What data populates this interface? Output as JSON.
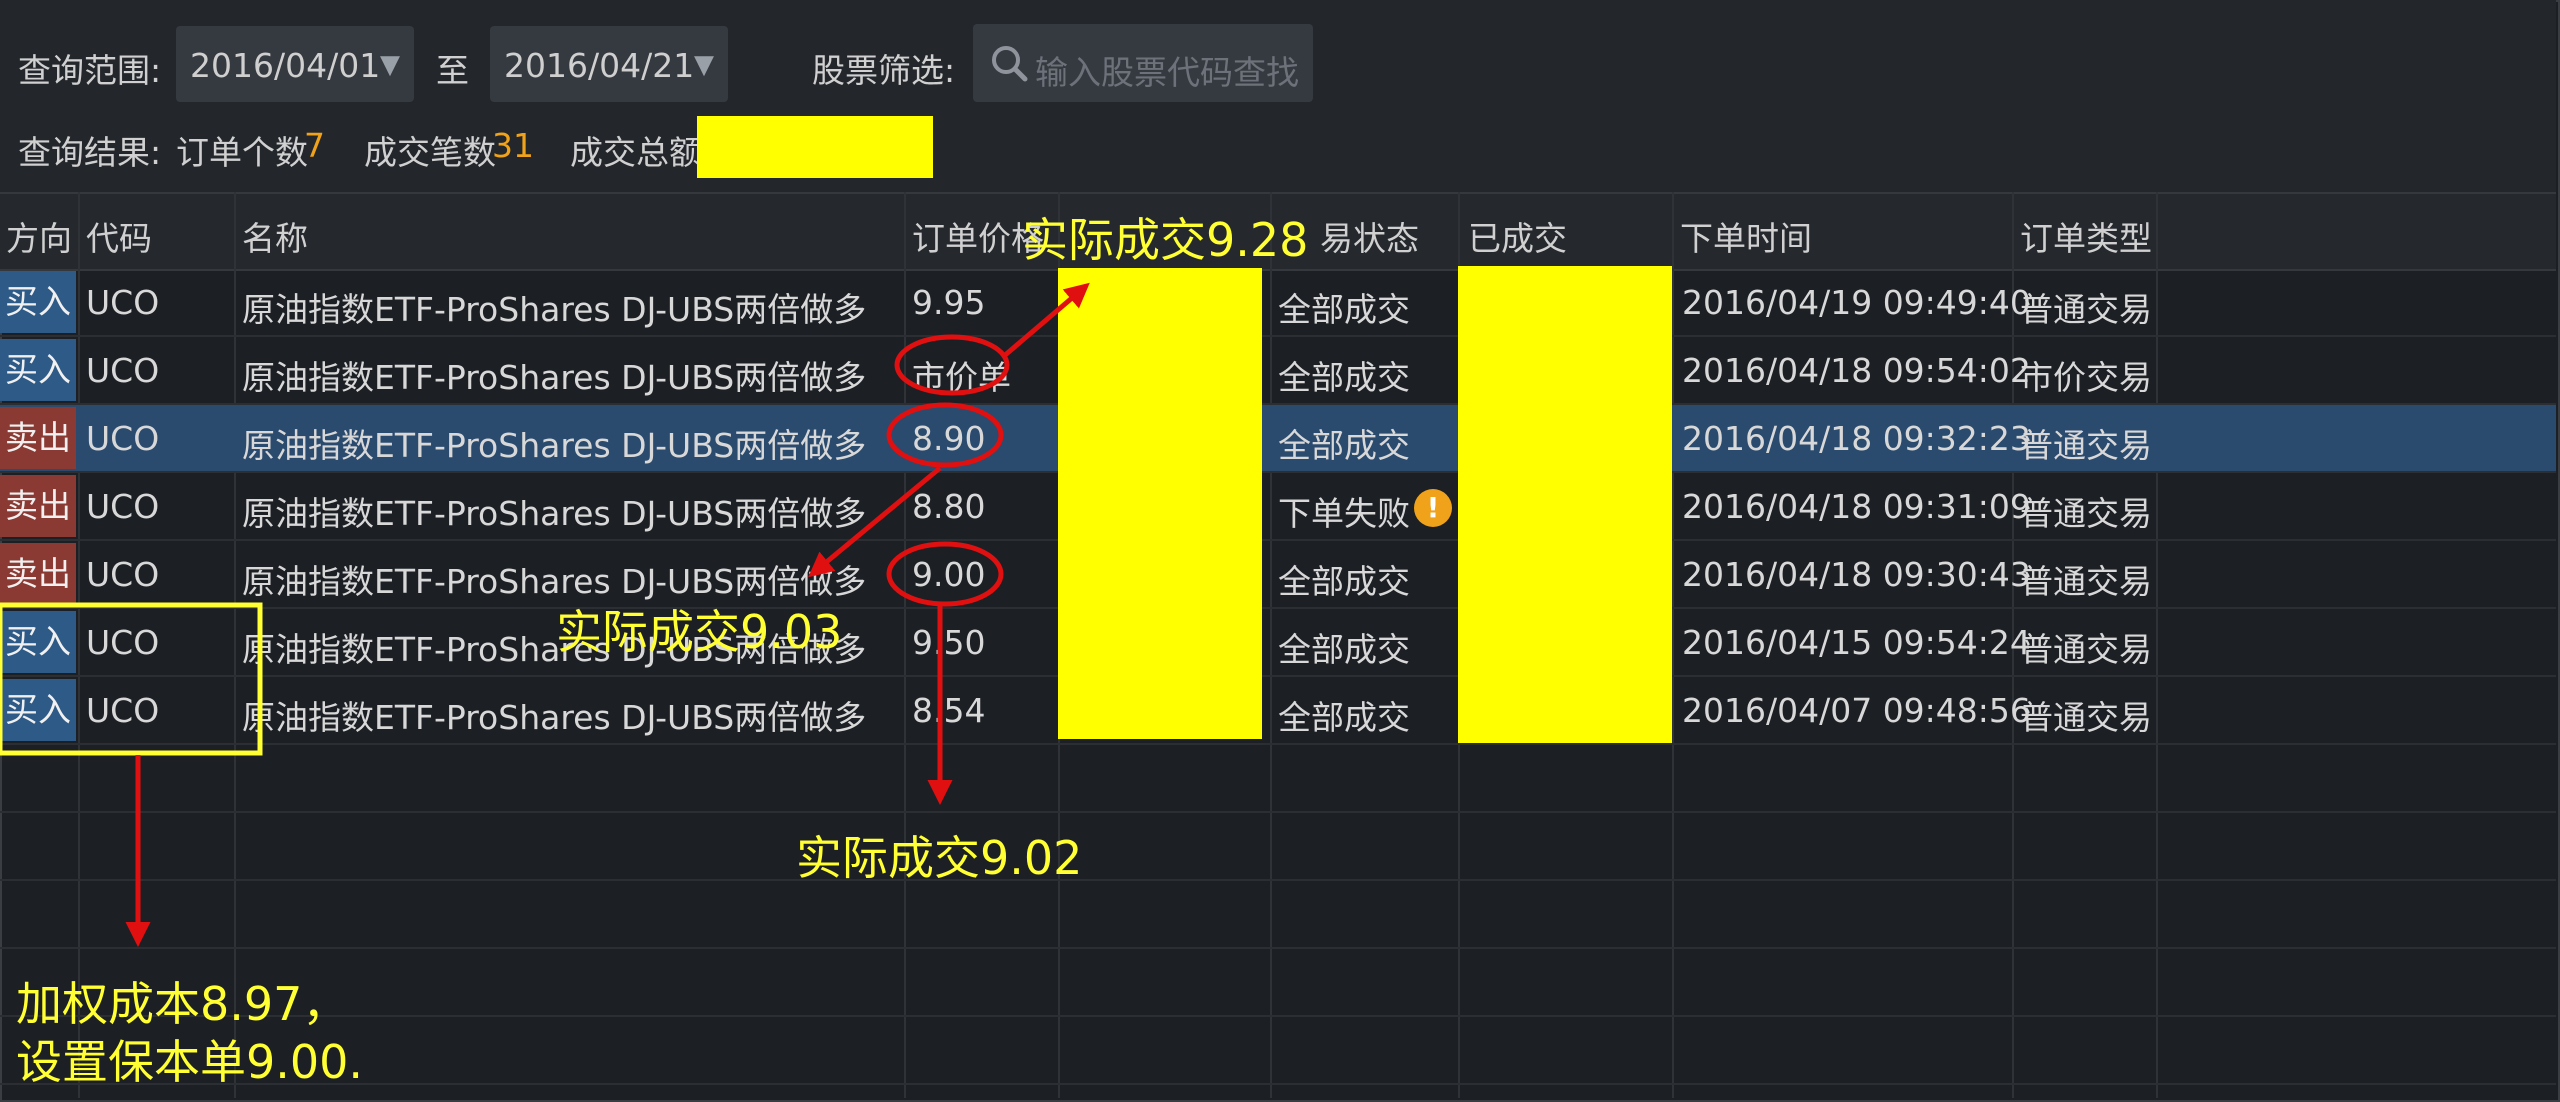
{
  "filter": {
    "range_label": "查询范围:",
    "date_from": "2016/04/01",
    "to_label": "至",
    "date_to": "2016/04/21",
    "stock_filter_label": "股票筛选:",
    "search_placeholder": "输入股票代码查找"
  },
  "result": {
    "label": "查询结果:",
    "orders_label": "订单个数",
    "orders_count": "7",
    "deals_label": "成交笔数",
    "deals_count": "31",
    "amount_label": "成交总额"
  },
  "columns": {
    "direction": "方向",
    "code": "代码",
    "name": "名称",
    "price": "订单价格",
    "status": "易状态",
    "filled": "已成交",
    "time": "下单时间",
    "type": "订单类型"
  },
  "rows": [
    {
      "direction": "买入",
      "code": "UCO",
      "name": "原油指数ETF-ProShares DJ-UBS两倍做多",
      "price": "9.95",
      "status": "全部成交",
      "time": "2016/04/19 09:49:40",
      "type": "普通交易"
    },
    {
      "direction": "买入",
      "code": "UCO",
      "name": "原油指数ETF-ProShares DJ-UBS两倍做多",
      "price": "市价单",
      "status": "全部成交",
      "time": "2016/04/18 09:54:02",
      "type": "市价交易"
    },
    {
      "direction": "卖出",
      "code": "UCO",
      "name": "原油指数ETF-ProShares DJ-UBS两倍做多",
      "price": "8.90",
      "status": "全部成交",
      "time": "2016/04/18 09:32:23",
      "type": "普通交易"
    },
    {
      "direction": "卖出",
      "code": "UCO",
      "name": "原油指数ETF-ProShares DJ-UBS两倍做多",
      "price": "8.80",
      "status": "下单失败",
      "time": "2016/04/18 09:31:09",
      "type": "普通交易"
    },
    {
      "direction": "卖出",
      "code": "UCO",
      "name": "原油指数ETF-ProShares DJ-UBS两倍做多",
      "price": "9.00",
      "status": "全部成交",
      "time": "2016/04/18 09:30:43",
      "type": "普通交易"
    },
    {
      "direction": "买入",
      "code": "UCO",
      "name": "原油指数ETF-ProShares DJ-UBS两倍做多",
      "price": "9.50",
      "status": "全部成交",
      "time": "2016/04/15 09:54:24",
      "type": "普通交易"
    },
    {
      "direction": "买入",
      "code": "UCO",
      "name": "原油指数ETF-ProShares DJ-UBS两倍做多",
      "price": "8.54",
      "status": "全部成交",
      "time": "2016/04/07 09:48:56",
      "type": "普通交易"
    }
  ],
  "annotations": {
    "actual_928": "实际成交9.28",
    "actual_903": "实际成交9.03",
    "actual_902": "实际成交9.02",
    "cost_line1": "加权成本8.97，",
    "cost_line2": "设置保本单9.00."
  },
  "colors": {
    "buy": "#2e5a88",
    "sell": "#8a3a32",
    "highlight": "#ffff00",
    "annotation": "#ffff33",
    "arrow": "#e01010",
    "count": "#f0a21a"
  }
}
